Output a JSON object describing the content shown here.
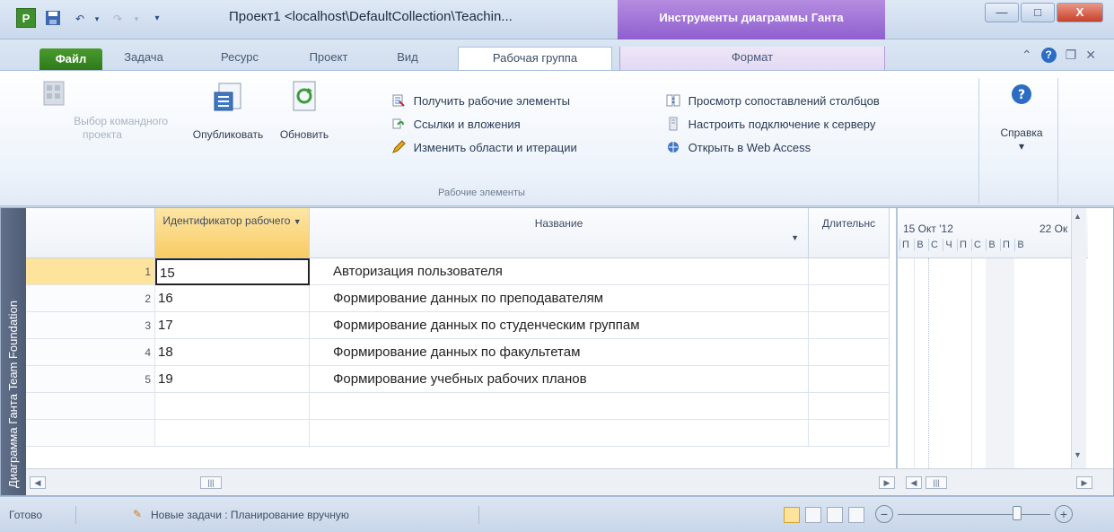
{
  "window": {
    "app_icon_letter": "P",
    "title": "Проект1 <localhost\\DefaultCollection\\Teachin...",
    "context_tab": "Инструменты диаграммы Ганта",
    "minimize": "—",
    "maximize": "□",
    "close": "X"
  },
  "tabs": {
    "file": "Файл",
    "task": "Задача",
    "resource": "Ресурс",
    "project": "Проект",
    "view": "Вид",
    "team": "Рабочая группа",
    "format": "Формат"
  },
  "ribbon": {
    "select_team_project": "Выбор командного проекта",
    "publish": "Опубликовать",
    "refresh": "Обновить",
    "get_work_items": "Получить рабочие элементы",
    "links_attachments": "Ссылки и вложения",
    "edit_areas": "Изменить области и итерации",
    "column_mapping": "Просмотр сопоставлений столбцов",
    "configure_server": "Настроить подключение к серверу",
    "open_web_access": "Открыть в Web Access",
    "group_work_items": "Рабочие элементы",
    "help": "Справка",
    "help_arrow": "▾"
  },
  "sidebar": {
    "label": "Диаграмма Ганта Team Foundation"
  },
  "grid": {
    "headers": {
      "work_item_id": "Идентификатор рабочего",
      "name": "Название",
      "duration": "Длительнс"
    },
    "rows": [
      {
        "num": "1",
        "id": "15",
        "name": "Авторизация пользователя"
      },
      {
        "num": "2",
        "id": "16",
        "name": "Формирование данных по преподавателям"
      },
      {
        "num": "3",
        "id": "17",
        "name": "Формирование данных по студенческим группам"
      },
      {
        "num": "4",
        "id": "18",
        "name": "Формирование данных по факультетам"
      },
      {
        "num": "5",
        "id": "19",
        "name": "Формирование учебных рабочих планов"
      }
    ]
  },
  "gantt": {
    "week1": "15 Окт '12",
    "week2": "22 Ок",
    "days": [
      "П",
      "В",
      "С",
      "Ч",
      "П",
      "С",
      "В",
      "П",
      "В"
    ]
  },
  "status": {
    "ready": "Готово",
    "new_tasks": "Новые задачи : Планирование вручную",
    "zoom_minus": "−",
    "zoom_plus": "+"
  }
}
